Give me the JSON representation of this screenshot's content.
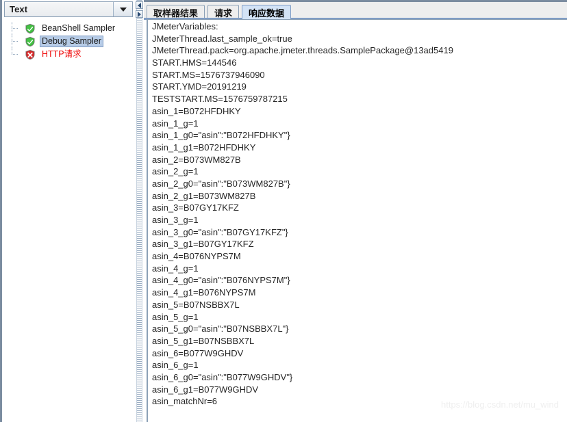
{
  "left_panel": {
    "combo": {
      "name": "render-format-combo",
      "value": "Text",
      "arrow_icon": "chevron-down-icon"
    },
    "tree": {
      "items": [
        {
          "label": "BeanShell Sampler",
          "status": "success",
          "icon": "green-shield-check-icon",
          "selected": false
        },
        {
          "label": "Debug Sampler",
          "status": "success",
          "icon": "green-shield-check-icon",
          "selected": true
        },
        {
          "label": "HTTP请求",
          "status": "error",
          "icon": "red-shield-cross-icon",
          "selected": false
        }
      ]
    }
  },
  "splitter": {
    "collapse_left_icon": "triangle-left-icon",
    "collapse_right_icon": "triangle-right-icon"
  },
  "right_panel": {
    "tabs": [
      {
        "label": "取样器结果",
        "selected": false
      },
      {
        "label": "请求",
        "selected": false
      },
      {
        "label": "响应数据",
        "selected": true
      }
    ],
    "response_text_lines": [
      "JMeterVariables:",
      "JMeterThread.last_sample_ok=true",
      "JMeterThread.pack=org.apache.jmeter.threads.SamplePackage@13ad5419",
      "START.HMS=144546",
      "START.MS=1576737946090",
      "START.YMD=20191219",
      "TESTSTART.MS=1576759787215",
      "asin_1=B072HFDHKY",
      "asin_1_g=1",
      "asin_1_g0=\"asin\":\"B072HFDHKY\"}",
      "asin_1_g1=B072HFDHKY",
      "asin_2=B073WM827B",
      "asin_2_g=1",
      "asin_2_g0=\"asin\":\"B073WM827B\"}",
      "asin_2_g1=B073WM827B",
      "asin_3=B07GY17KFZ",
      "asin_3_g=1",
      "asin_3_g0=\"asin\":\"B07GY17KFZ\"}",
      "asin_3_g1=B07GY17KFZ",
      "asin_4=B076NYPS7M",
      "asin_4_g=1",
      "asin_4_g0=\"asin\":\"B076NYPS7M\"}",
      "asin_4_g1=B076NYPS7M",
      "asin_5=B07NSBBX7L",
      "asin_5_g=1",
      "asin_5_g0=\"asin\":\"B07NSBBX7L\"}",
      "asin_5_g1=B07NSBBX7L",
      "asin_6=B077W9GHDV",
      "asin_6_g=1",
      "asin_6_g0=\"asin\":\"B077W9GHDV\"}",
      "asin_6_g1=B077W9GHDV",
      "asin_matchNr=6"
    ]
  },
  "watermark": {
    "text": "https://blog.csdn.net/mu_wind"
  },
  "colors": {
    "selected_tab_bg": "#d3e3f6",
    "tab_border": "#7f9cc4",
    "tree_selection_bg": "#b6cbe6",
    "error_text": "#ee0000",
    "success_icon": "#2aa12a",
    "error_icon": "#cc2222",
    "splitter": "#9aadc2",
    "window_edge": "#7b8ca0"
  }
}
